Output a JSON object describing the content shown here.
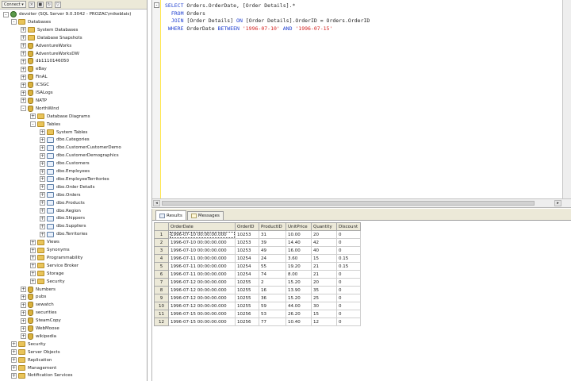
{
  "explorer": {
    "connect_label": "Connect",
    "tree": [
      {
        "label": "devsiter (SQL Server 9.0.3042 - PROZAC\\mikeblais)",
        "level": 0,
        "icon": "server",
        "exp": "-"
      },
      {
        "label": "Databases",
        "level": 1,
        "icon": "folder",
        "exp": "-"
      },
      {
        "label": "System Databases",
        "level": 2,
        "icon": "folder",
        "exp": "+"
      },
      {
        "label": "Database Snapshots",
        "level": 2,
        "icon": "folder",
        "exp": "+"
      },
      {
        "label": "AdventureWorks",
        "level": 2,
        "icon": "db",
        "exp": "+"
      },
      {
        "label": "AdventureWorksDW",
        "level": 2,
        "icon": "db",
        "exp": "+"
      },
      {
        "label": "db1110146050",
        "level": 2,
        "icon": "db",
        "exp": "+"
      },
      {
        "label": "eBay",
        "level": 2,
        "icon": "db",
        "exp": "+"
      },
      {
        "label": "FinAL",
        "level": 2,
        "icon": "db",
        "exp": "+"
      },
      {
        "label": "ICSGC",
        "level": 2,
        "icon": "db",
        "exp": "+"
      },
      {
        "label": "ISALogs",
        "level": 2,
        "icon": "db",
        "exp": "+"
      },
      {
        "label": "NATP",
        "level": 2,
        "icon": "db",
        "exp": "+"
      },
      {
        "label": "NorthWind",
        "level": 2,
        "icon": "db",
        "exp": "-"
      },
      {
        "label": "Database Diagrams",
        "level": 3,
        "icon": "folder",
        "exp": "+"
      },
      {
        "label": "Tables",
        "level": 3,
        "icon": "folder",
        "exp": "-"
      },
      {
        "label": "System Tables",
        "level": 4,
        "icon": "folder",
        "exp": "+"
      },
      {
        "label": "dbo.Categories",
        "level": 4,
        "icon": "table",
        "exp": "+"
      },
      {
        "label": "dbo.CustomerCustomerDemo",
        "level": 4,
        "icon": "table",
        "exp": "+"
      },
      {
        "label": "dbo.CustomerDemographics",
        "level": 4,
        "icon": "table",
        "exp": "+"
      },
      {
        "label": "dbo.Customers",
        "level": 4,
        "icon": "table",
        "exp": "+"
      },
      {
        "label": "dbo.Employees",
        "level": 4,
        "icon": "table",
        "exp": "+"
      },
      {
        "label": "dbo.EmployeeTerritories",
        "level": 4,
        "icon": "table",
        "exp": "+"
      },
      {
        "label": "dbo.Order Details",
        "level": 4,
        "icon": "table",
        "exp": "+"
      },
      {
        "label": "dbo.Orders",
        "level": 4,
        "icon": "table",
        "exp": "+"
      },
      {
        "label": "dbo.Products",
        "level": 4,
        "icon": "table",
        "exp": "+"
      },
      {
        "label": "dbo.Region",
        "level": 4,
        "icon": "table",
        "exp": "+"
      },
      {
        "label": "dbo.Shippers",
        "level": 4,
        "icon": "table",
        "exp": "+"
      },
      {
        "label": "dbo.Suppliers",
        "level": 4,
        "icon": "table",
        "exp": "+"
      },
      {
        "label": "dbo.Territories",
        "level": 4,
        "icon": "table",
        "exp": "+"
      },
      {
        "label": "Views",
        "level": 3,
        "icon": "folder",
        "exp": "+"
      },
      {
        "label": "Synonyms",
        "level": 3,
        "icon": "folder",
        "exp": "+"
      },
      {
        "label": "Programmability",
        "level": 3,
        "icon": "folder",
        "exp": "+"
      },
      {
        "label": "Service Broker",
        "level": 3,
        "icon": "folder",
        "exp": "+"
      },
      {
        "label": "Storage",
        "level": 3,
        "icon": "folder",
        "exp": "+"
      },
      {
        "label": "Security",
        "level": 3,
        "icon": "folder",
        "exp": "+"
      },
      {
        "label": "Numbers",
        "level": 2,
        "icon": "db",
        "exp": "+"
      },
      {
        "label": "pubs",
        "level": 2,
        "icon": "db",
        "exp": "+"
      },
      {
        "label": "sewatch",
        "level": 2,
        "icon": "db",
        "exp": "+"
      },
      {
        "label": "securities",
        "level": 2,
        "icon": "db",
        "exp": "+"
      },
      {
        "label": "SteamCopy",
        "level": 2,
        "icon": "db",
        "exp": "+"
      },
      {
        "label": "WebMoose",
        "level": 2,
        "icon": "db",
        "exp": "+"
      },
      {
        "label": "wikipedia",
        "level": 2,
        "icon": "db",
        "exp": "+"
      },
      {
        "label": "Security",
        "level": 1,
        "icon": "folder",
        "exp": "+"
      },
      {
        "label": "Server Objects",
        "level": 1,
        "icon": "folder",
        "exp": "+"
      },
      {
        "label": "Replication",
        "level": 1,
        "icon": "folder",
        "exp": "+"
      },
      {
        "label": "Management",
        "level": 1,
        "icon": "folder",
        "exp": "+"
      },
      {
        "label": "Notification Services",
        "level": 1,
        "icon": "folder",
        "exp": "+"
      }
    ]
  },
  "editor": {
    "collapse_glyph": "-",
    "sql_lines": [
      [
        {
          "t": "SELECT ",
          "c": "kw"
        },
        {
          "t": "Orders.OrderDate, [Order Details].*",
          "c": "pl"
        }
      ],
      [
        {
          "t": "  FROM ",
          "c": "kw"
        },
        {
          "t": "Orders",
          "c": "pl"
        }
      ],
      [
        {
          "t": "  JOIN ",
          "c": "kw"
        },
        {
          "t": "[Order Details] ",
          "c": "pl"
        },
        {
          "t": "ON ",
          "c": "kw"
        },
        {
          "t": "[Order Details].OrderID = Orders.OrderID",
          "c": "pl"
        }
      ],
      [
        {
          "t": " WHERE ",
          "c": "kw"
        },
        {
          "t": "OrderDate ",
          "c": "pl"
        },
        {
          "t": "BETWEEN ",
          "c": "kw"
        },
        {
          "t": "'1996-07-10'",
          "c": "str"
        },
        {
          "t": " AND ",
          "c": "kw"
        },
        {
          "t": "'1996-07-15'",
          "c": "str"
        }
      ]
    ]
  },
  "results": {
    "tabs": [
      {
        "label": "Results",
        "active": true
      },
      {
        "label": "Messages",
        "active": false
      }
    ],
    "columns": [
      "OrderDate",
      "OrderID",
      "ProductID",
      "UnitPrice",
      "Quantity",
      "Discount"
    ],
    "rows": [
      [
        "1996-07-10 00:00:00.000",
        "10253",
        "31",
        "10.00",
        "20",
        "0"
      ],
      [
        "1996-07-10 00:00:00.000",
        "10253",
        "39",
        "14.40",
        "42",
        "0"
      ],
      [
        "1996-07-10 00:00:00.000",
        "10253",
        "49",
        "16.00",
        "40",
        "0"
      ],
      [
        "1996-07-11 00:00:00.000",
        "10254",
        "24",
        "3.60",
        "15",
        "0.15"
      ],
      [
        "1996-07-11 00:00:00.000",
        "10254",
        "55",
        "19.20",
        "21",
        "0.15"
      ],
      [
        "1996-07-11 00:00:00.000",
        "10254",
        "74",
        "8.00",
        "21",
        "0"
      ],
      [
        "1996-07-12 00:00:00.000",
        "10255",
        "2",
        "15.20",
        "20",
        "0"
      ],
      [
        "1996-07-12 00:00:00.000",
        "10255",
        "16",
        "13.90",
        "35",
        "0"
      ],
      [
        "1996-07-12 00:00:00.000",
        "10255",
        "36",
        "15.20",
        "25",
        "0"
      ],
      [
        "1996-07-12 00:00:00.000",
        "10255",
        "59",
        "44.00",
        "30",
        "0"
      ],
      [
        "1996-07-15 00:00:00.000",
        "10256",
        "53",
        "26.20",
        "15",
        "0"
      ],
      [
        "1996-07-15 00:00:00.000",
        "10256",
        "77",
        "10.40",
        "12",
        "0"
      ]
    ]
  }
}
